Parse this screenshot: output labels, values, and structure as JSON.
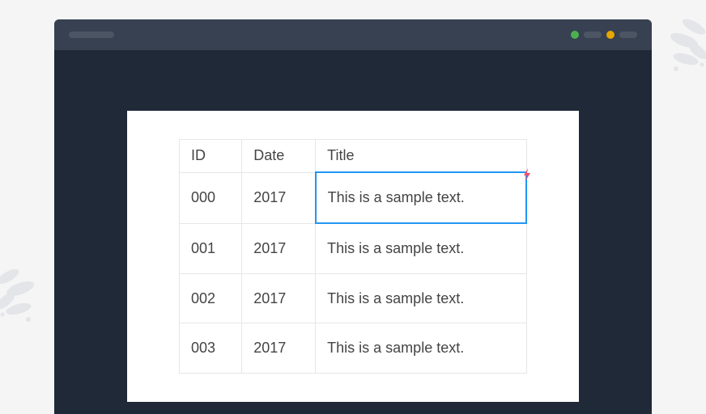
{
  "table": {
    "headers": {
      "id": "ID",
      "date": "Date",
      "title": "Title"
    },
    "rows": [
      {
        "id": "000",
        "date": "2017",
        "title": "This is a sample text."
      },
      {
        "id": "001",
        "date": "2017",
        "title": "This is a sample text."
      },
      {
        "id": "002",
        "date": "2017",
        "title": "This is a sample text."
      },
      {
        "id": "003",
        "date": "2017",
        "title": "This is a sample text."
      }
    ]
  },
  "selection": {
    "row": 0,
    "column": "title"
  }
}
